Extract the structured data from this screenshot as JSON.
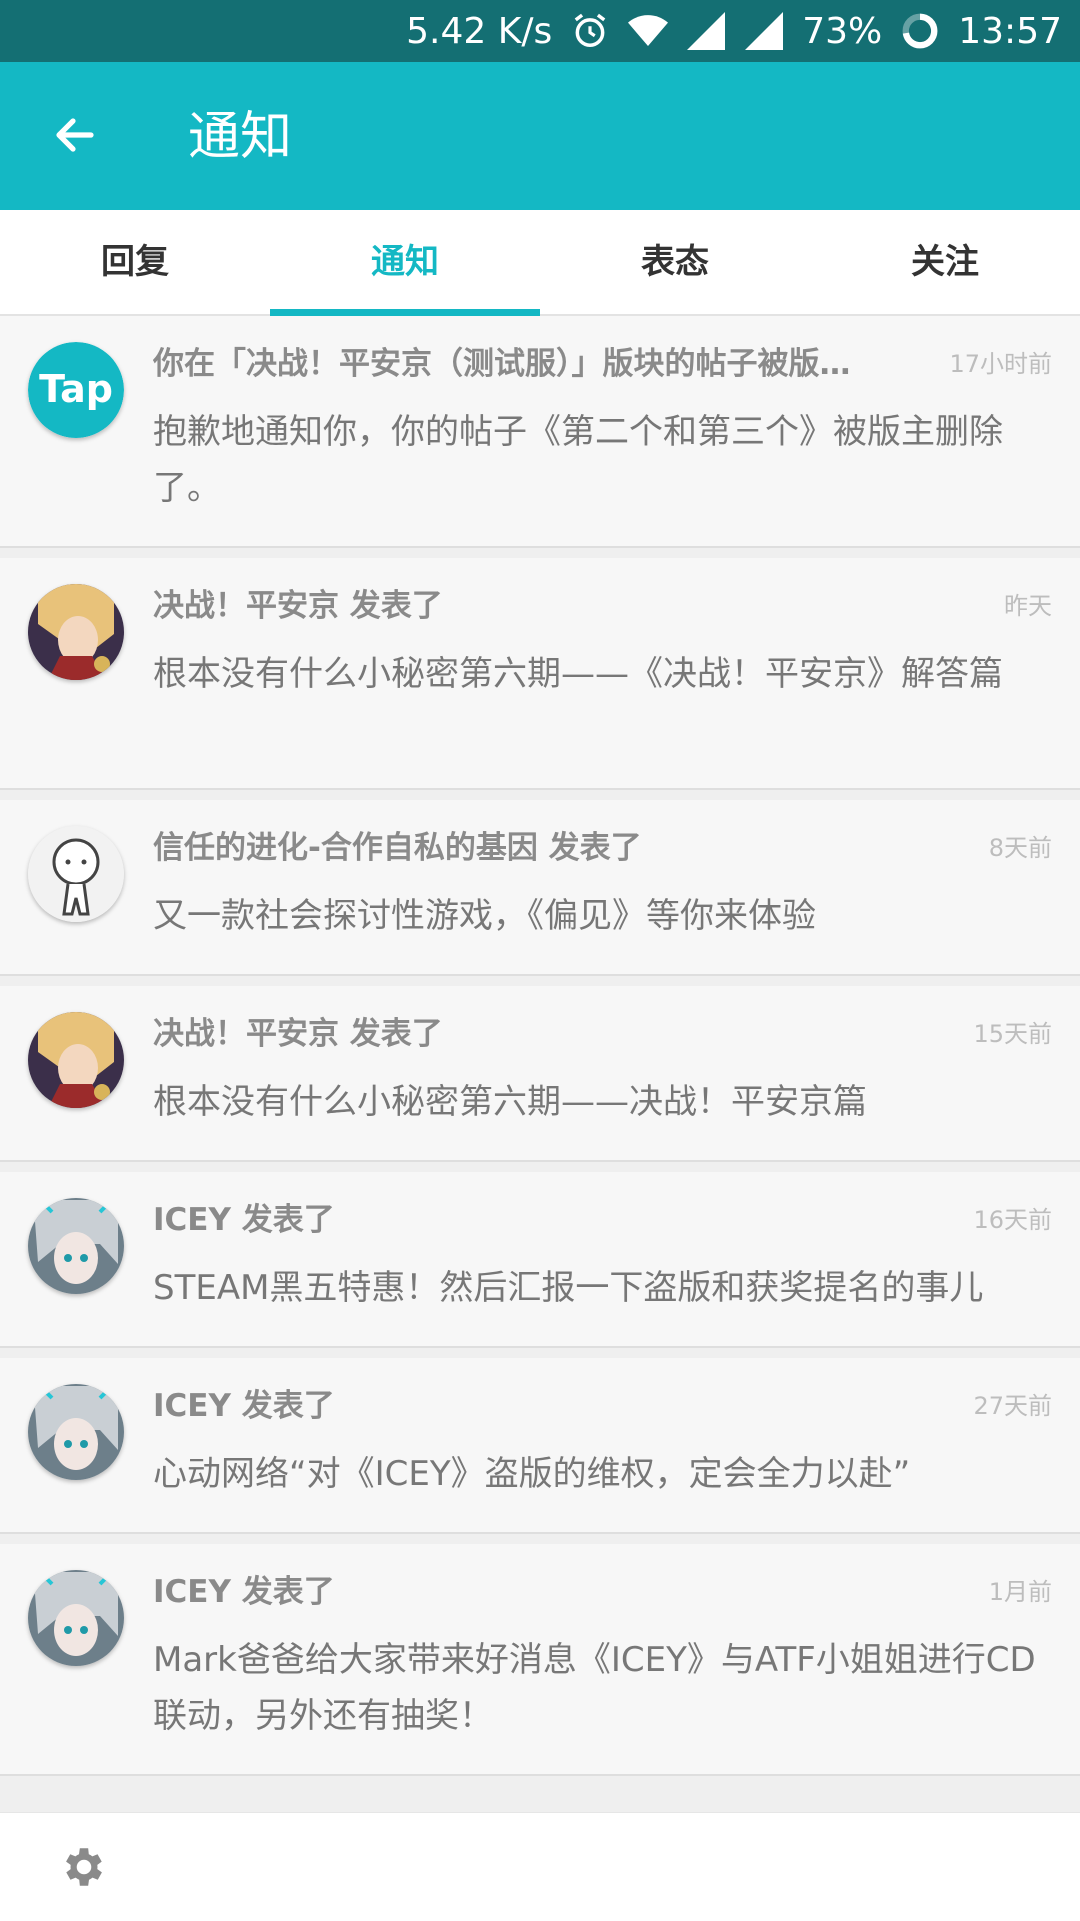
{
  "status_bar": {
    "speed": "5.42 K/s",
    "battery": "73%",
    "time": "13:57"
  },
  "app_bar": {
    "title": "通知"
  },
  "tabs": [
    {
      "label": "回复"
    },
    {
      "label": "通知",
      "active": true
    },
    {
      "label": "表态"
    },
    {
      "label": "关注"
    }
  ],
  "notifications": [
    {
      "avatar": "tap-logo",
      "title": "你在「决战！平安京（测试服）」版块的帖子被版主删除了",
      "time": "17小时前",
      "body": "抱歉地通知你，你的帖子《第二个和第三个》被版主删除了。"
    },
    {
      "avatar": "onmyoji-character",
      "title": "决战！平安京 发表了",
      "time": "昨天",
      "body": "根本没有什么小秘密第六期——《决战！平安京》解答篇"
    },
    {
      "avatar": "stick-figure",
      "title": "信任的进化-合作自私的基因 发表了",
      "time": "8天前",
      "body": "又一款社会探讨性游戏，《偏见》等你来体验"
    },
    {
      "avatar": "onmyoji-character",
      "title": "决战！平安京 发表了",
      "time": "15天前",
      "body": "根本没有什么小秘密第六期——决战！平安京篇"
    },
    {
      "avatar": "icey-character",
      "title": "ICEY 发表了",
      "time": "16天前",
      "body": "STEAM黑五特惠！然后汇报一下盗版和获奖提名的事儿"
    },
    {
      "avatar": "icey-character",
      "title": "ICEY 发表了",
      "time": "27天前",
      "body": "心动网络“对《ICEY》盗版的维权，定会全力以赴”"
    },
    {
      "avatar": "icey-character",
      "title": "ICEY 发表了",
      "time": "1月前",
      "body": "Mark爸爸给大家带来好消息《ICEY》与ATF小姐姐进行CD联动，另外还有抽奖！"
    }
  ],
  "colors": {
    "accent": "#14b8c4",
    "status_bar": "#146f73"
  }
}
